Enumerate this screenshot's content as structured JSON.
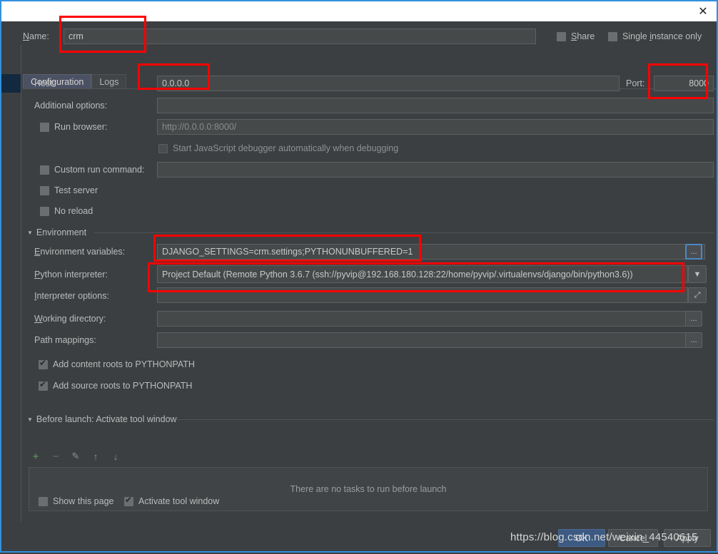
{
  "window": {
    "close_icon": "close-icon"
  },
  "name_row": {
    "label": "Name:",
    "value": "crm",
    "share_label": "Share",
    "share_checked": false,
    "single_instance_label": "Single instance only",
    "single_instance_checked": false
  },
  "tabs": [
    {
      "label": "Configuration",
      "active": true
    },
    {
      "label": "Logs",
      "active": false
    }
  ],
  "fields": {
    "host_label": "Host:",
    "host_value": "0.0.0.0",
    "port_label": "Port:",
    "port_value": "8000",
    "additional_options_label": "Additional options:",
    "additional_options_value": "",
    "run_browser_label": "Run browser:",
    "run_browser_checked": false,
    "run_browser_url": "http://0.0.0.0:8000/",
    "js_debugger_label": "Start JavaScript debugger automatically when debugging",
    "js_debugger_checked": false,
    "custom_run_command_label": "Custom run command:",
    "custom_run_command_checked": false,
    "custom_run_command_value": "",
    "test_server_label": "Test server",
    "test_server_checked": false,
    "no_reload_label": "No reload",
    "no_reload_checked": false
  },
  "environment": {
    "group_label": "Environment",
    "env_vars_label": "Environment variables:",
    "env_vars_value": "DJANGO_SETTINGS=crm.settings;PYTHONUNBUFFERED=1",
    "env_vars_browse": "...",
    "interpreter_label": "Python interpreter:",
    "interpreter_value": "Project Default (Remote Python 3.6.7 (ssh://pyvip@192.168.180.128:22/home/pyvip/.virtualenvs/django/bin/python3.6))",
    "interpreter_dropdown_icon": "chevron-down-icon",
    "interpreter_options_label": "Interpreter options:",
    "interpreter_options_value": "",
    "interpreter_options_expand_icon": "expand-icon",
    "working_directory_label": "Working directory:",
    "working_directory_value": "",
    "working_directory_browse": "...",
    "path_mappings_label": "Path mappings:",
    "path_mappings_value": "",
    "path_mappings_browse": "...",
    "add_content_roots_label": "Add content roots to PYTHONPATH",
    "add_content_roots_checked": true,
    "add_source_roots_label": "Add source roots to PYTHONPATH",
    "add_source_roots_checked": true
  },
  "before_launch": {
    "group_label": "Before launch: Activate tool window",
    "toolbar": [
      {
        "name": "add-task-button",
        "glyph": "+",
        "color": "#5ca75c"
      },
      {
        "name": "remove-task-button",
        "glyph": "−",
        "color": "#6d7172"
      },
      {
        "name": "edit-task-button",
        "glyph": "✎",
        "color": "#8d9091"
      },
      {
        "name": "move-up-button",
        "glyph": "↑",
        "color": "#8d9091"
      },
      {
        "name": "move-down-button",
        "glyph": "↓",
        "color": "#8d9091"
      }
    ],
    "empty_text": "There are no tasks to run before launch",
    "show_this_page_label": "Show this page",
    "show_this_page_checked": false,
    "activate_tool_window_label": "Activate tool window",
    "activate_tool_window_checked": true
  },
  "dialog_buttons": {
    "ok": "OK",
    "cancel": "Cancel",
    "apply": "Apply"
  },
  "watermark": {
    "text": "https://blog.csdn.net/weixin_44540615"
  },
  "colors": {
    "background": "#3c3f41",
    "field": "#45494a",
    "accent_border": "#3390dd",
    "annotation": "#fe0000",
    "tab_active": "#4b5163",
    "add_icon": "#5ca75c"
  }
}
